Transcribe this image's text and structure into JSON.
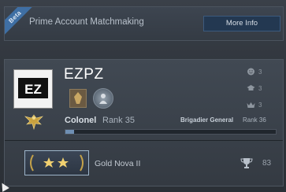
{
  "prime": {
    "beta_label": "Beta",
    "title": "Prime Account Matchmaking",
    "more_info_label": "More Info"
  },
  "profile": {
    "username": "EZPZ",
    "avatar_text": "EZ",
    "stats": [
      {
        "icon": "smiley-icon",
        "value": "3"
      },
      {
        "icon": "teacher-icon",
        "value": "3"
      },
      {
        "icon": "crown-icon",
        "value": "3"
      }
    ],
    "rank": {
      "name": "Colonel",
      "level": "Rank 35",
      "next_name": "Brigadier General",
      "next_level": "Rank 36",
      "xp_progress": 0.04
    },
    "skill_group": {
      "name": "Gold Nova II",
      "stars": 2
    },
    "wins": "83"
  },
  "colors": {
    "accent": "#3f6fa4",
    "button": "#233851",
    "xp": "#6f8fb3"
  }
}
